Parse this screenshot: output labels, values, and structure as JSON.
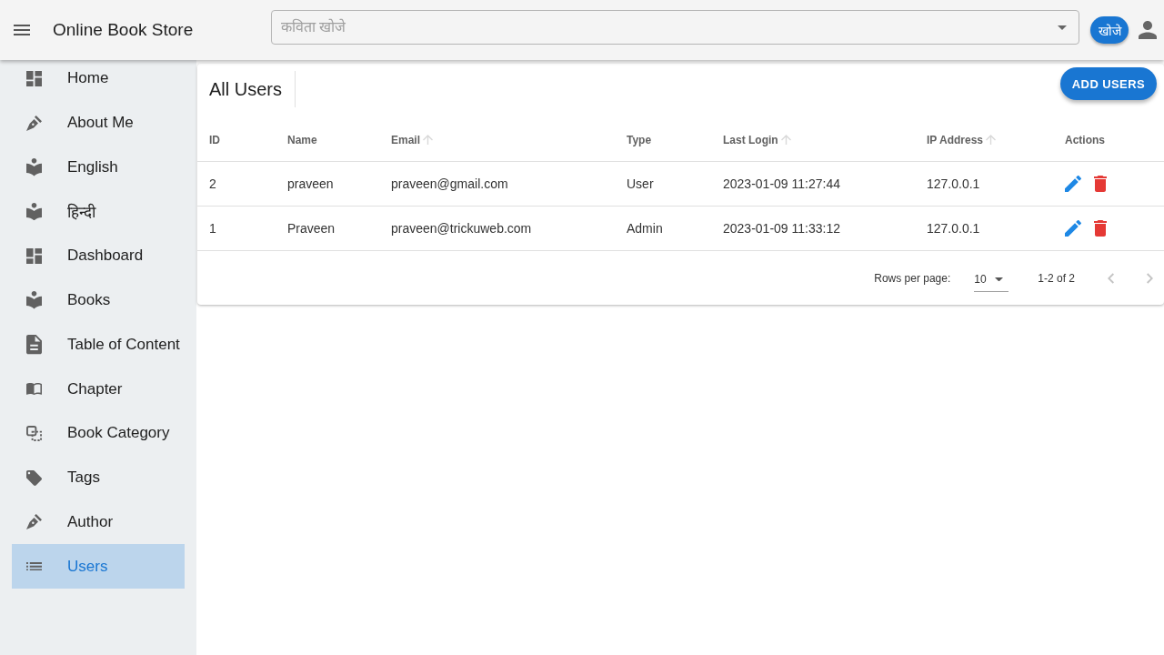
{
  "app_bar": {
    "title": "Online Book Store",
    "search": {
      "placeholder": "कविता खोजे"
    },
    "search_button": "खोजे"
  },
  "sidebar": {
    "items": [
      {
        "label": "Home",
        "kind": "dashboard",
        "selected": false
      },
      {
        "label": "About Me",
        "kind": "pen",
        "selected": false
      },
      {
        "label": "English",
        "kind": "reader",
        "selected": false
      },
      {
        "label": "हिन्दी",
        "kind": "reader",
        "selected": false
      },
      {
        "label": "Dashboard",
        "kind": "dashboard",
        "selected": false
      },
      {
        "label": "Books",
        "kind": "reader",
        "selected": false
      },
      {
        "label": "Table of Content",
        "kind": "document",
        "selected": false
      },
      {
        "label": "Chapter",
        "kind": "book",
        "selected": false
      },
      {
        "label": "Book Category",
        "kind": "category",
        "selected": false
      },
      {
        "label": "Tags",
        "kind": "tag",
        "selected": false
      },
      {
        "label": "Author",
        "kind": "pen",
        "selected": false
      },
      {
        "label": "Users",
        "kind": "list",
        "selected": true
      }
    ]
  },
  "content": {
    "title": "All Users",
    "add_button": "ADD USERS",
    "table": {
      "columns": [
        {
          "label": "ID",
          "kind": "text",
          "sortable": false
        },
        {
          "label": "Name",
          "kind": "text",
          "sortable": false
        },
        {
          "label": "Email",
          "kind": "text",
          "sortable": true
        },
        {
          "label": "Type",
          "kind": "text",
          "sortable": false
        },
        {
          "label": "Last Login",
          "kind": "text",
          "sortable": true
        },
        {
          "label": "IP Address",
          "kind": "text",
          "sortable": true
        },
        {
          "label": "Actions",
          "kind": "actions",
          "sortable": false
        }
      ],
      "rows": [
        {
          "cells": [
            "2",
            "praveen",
            "praveen@gmail.com",
            "User",
            "2023-01-09 11:27:44",
            "127.0.0.1"
          ]
        },
        {
          "cells": [
            "1",
            "Praveen",
            "praveen@trickuweb.com",
            "Admin",
            "2023-01-09 11:33:12",
            "127.0.0.1"
          ]
        }
      ]
    },
    "pagination": {
      "rows_per_page_label": "Rows per page:",
      "rows_per_page": "10",
      "range": "1-2 of 2",
      "previous": {
        "disabled": true
      },
      "next": {
        "disabled": true
      }
    }
  }
}
